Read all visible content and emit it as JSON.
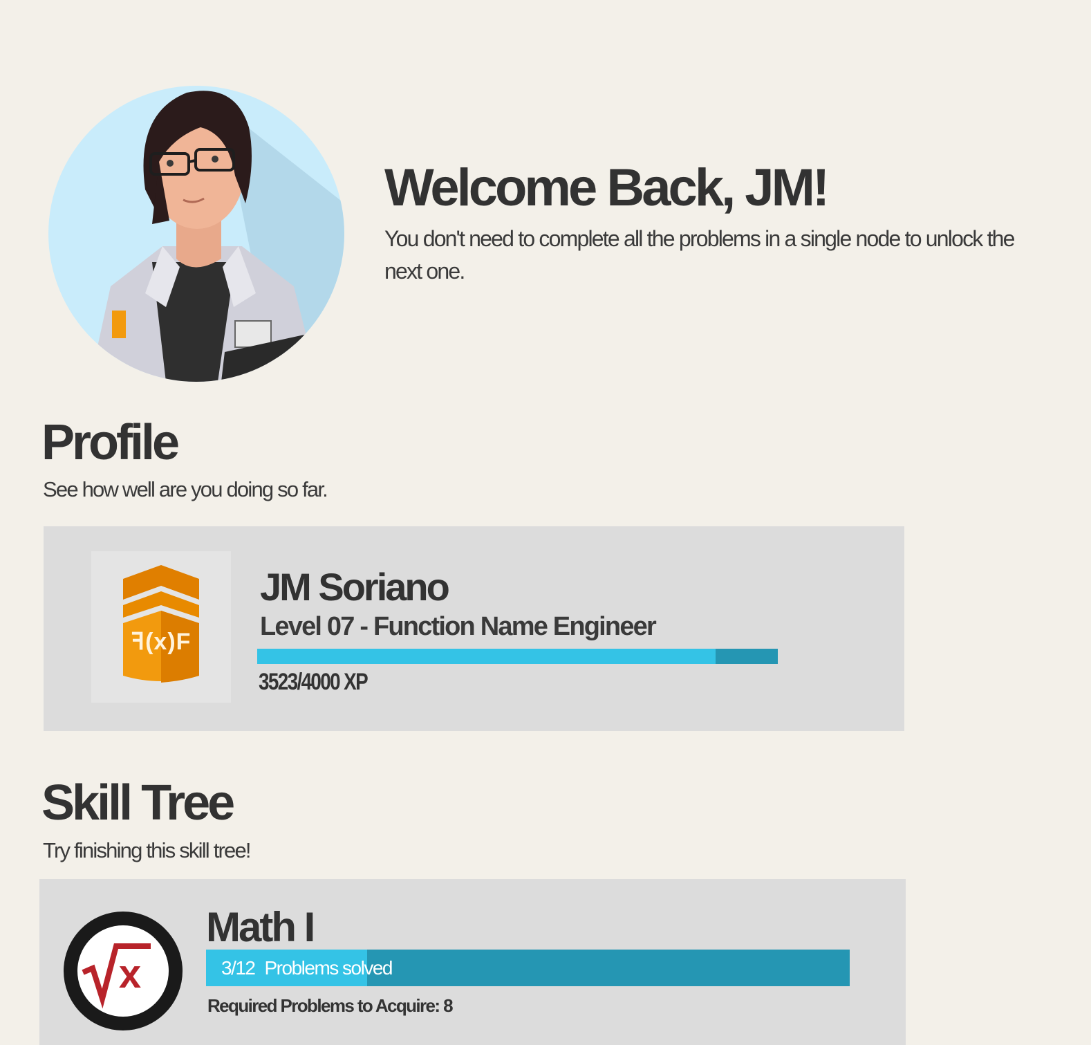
{
  "welcome": {
    "title": "Welcome Back, JM!",
    "subtitle": "You don't need to complete all the problems in a single node to unlock the next one."
  },
  "profile": {
    "title": "Profile",
    "subtitle": "See how well are you doing so far.",
    "name": "JM Soriano",
    "level": "Level 07 - Function Name Engineer",
    "xp_text": "3523/4000 XP",
    "xp_current": 3523,
    "xp_max": 4000,
    "badge_icon": "f(x)f-chevron-badge-icon"
  },
  "skill_tree": {
    "title": "Skill Tree",
    "subtitle": "Try finishing this skill tree!",
    "nodes": [
      {
        "name": "Math I",
        "icon": "square-root-x-icon",
        "progress_count": "3/12",
        "progress_label": "Problems solved",
        "solved": 3,
        "total": 12,
        "required": "Required Problems to Acquire: 8"
      }
    ]
  },
  "colors": {
    "background": "#f3f0e9",
    "card": "#dcdcdc",
    "bar_fill": "#34c3e6",
    "bar_track": "#2596b3",
    "badge_orange": "#f29a0e",
    "skill_red": "#b8232a"
  }
}
